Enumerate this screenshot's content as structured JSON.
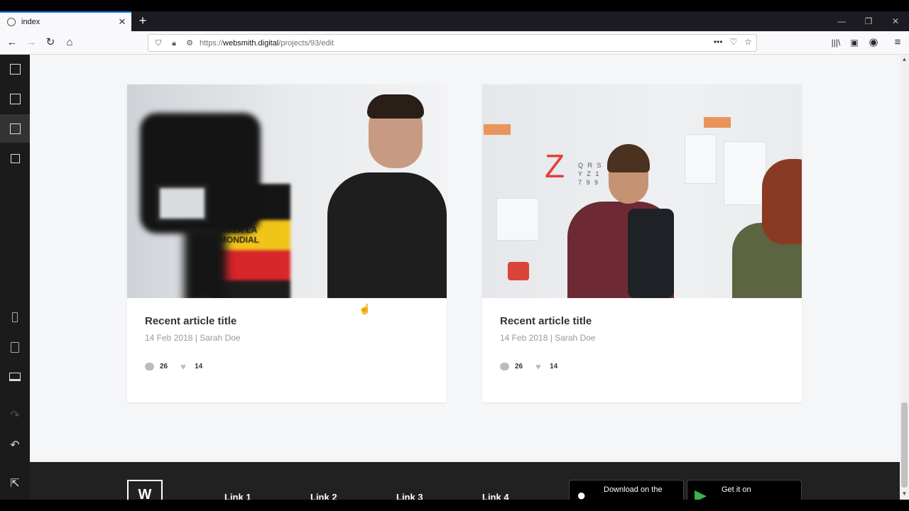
{
  "browser": {
    "tab_title": "index",
    "url_prefix": "https://",
    "url_host": "websmith.digital",
    "url_path": "/projects/93/edit"
  },
  "cards": [
    {
      "title": "Recent article title",
      "date": "14 Feb 2018",
      "author": "Sarah Doe",
      "separator": "|",
      "comments": "26",
      "likes": "14",
      "image_text": "AGZR LA\nMONDIAL"
    },
    {
      "title": "Recent article title",
      "date": "14 Feb 2018",
      "author": "Sarah Doe",
      "separator": "|",
      "comments": "26",
      "likes": "14",
      "image_text": "Z"
    }
  ],
  "footer": {
    "logo": "W",
    "links": [
      "Link 1",
      "Link 2",
      "Link 3",
      "Link 4"
    ],
    "app_store_label": "Download on the",
    "play_store_label": "Get it on"
  },
  "colors": {
    "accent_tab": "#0a84ff",
    "sidebar_bg": "#1b1b1b",
    "canvas_bg": "#f4f6f8",
    "footer_bg": "#212121"
  }
}
